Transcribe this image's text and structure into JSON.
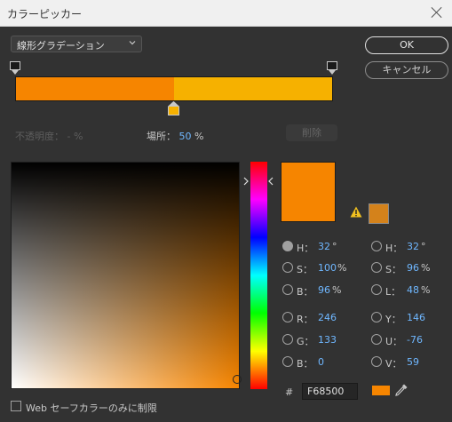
{
  "window": {
    "title": "カラーピッカー"
  },
  "gradient_type": {
    "value": "線形グラデーション"
  },
  "buttons": {
    "ok": "OK",
    "cancel": "キャンセル",
    "delete": "削除"
  },
  "stops": {
    "opacity_label": "不透明度：",
    "opacity_value": "-",
    "opacity_unit": "%",
    "location_label": "場所：",
    "location_value": "50",
    "location_unit": "%"
  },
  "colors": {
    "current": "#f68500",
    "gradient_right": "#f6b100",
    "web_safe": "#d4821b"
  },
  "fields": {
    "h1": {
      "label": "H：",
      "value": "32",
      "unit": "°"
    },
    "s1": {
      "label": "S：",
      "value": "100",
      "unit": "%"
    },
    "b1": {
      "label": "B：",
      "value": "96",
      "unit": "%"
    },
    "r": {
      "label": "R：",
      "value": "246",
      "unit": ""
    },
    "g": {
      "label": "G：",
      "value": "133",
      "unit": ""
    },
    "b2": {
      "label": "B：",
      "value": "0",
      "unit": ""
    },
    "h2": {
      "label": "H：",
      "value": "32",
      "unit": "°"
    },
    "s2": {
      "label": "S：",
      "value": "96",
      "unit": "%"
    },
    "l": {
      "label": "L：",
      "value": "48",
      "unit": "%"
    },
    "y": {
      "label": "Y：",
      "value": "146",
      "unit": ""
    },
    "u": {
      "label": "U：",
      "value": "-76",
      "unit": ""
    },
    "v": {
      "label": "V：",
      "value": "59",
      "unit": ""
    }
  },
  "hex": {
    "hash": "#",
    "value": "F68500"
  },
  "web_only": {
    "label": "Web セーフカラーのみに制限"
  }
}
